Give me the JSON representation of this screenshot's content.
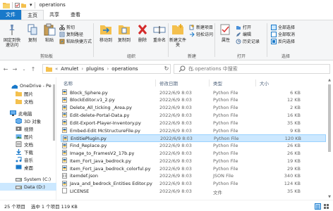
{
  "window": {
    "title": "operations"
  },
  "tabs": [
    {
      "label": "文件",
      "kind": "file"
    },
    {
      "label": "主页",
      "kind": "active"
    },
    {
      "label": "共享",
      "kind": "normal"
    },
    {
      "label": "查看",
      "kind": "normal"
    }
  ],
  "ribbon": {
    "clipboard": {
      "group_label": "剪贴板",
      "pin_label": "固定到快速访问",
      "copy_label": "复制",
      "paste_label": "粘贴",
      "cut_label": "剪切",
      "copy_path_label": "复制路径",
      "paste_shortcut_label": "粘贴快捷方式"
    },
    "organize": {
      "group_label": "组织",
      "move_to_label": "移动到",
      "copy_to_label": "复制到",
      "delete_label": "删除",
      "rename_label": "重命名"
    },
    "new": {
      "group_label": "新建",
      "new_folder_label": "新建文件夹",
      "new_item_label": "新建项目",
      "easy_access_label": "轻松访问"
    },
    "open": {
      "group_label": "打开",
      "properties_label": "属性",
      "open_label": "打开",
      "edit_label": "编辑",
      "history_label": "历史记录"
    },
    "select": {
      "group_label": "选择",
      "select_all_label": "全部选择",
      "select_none_label": "全部取消",
      "invert_label": "反向选择"
    }
  },
  "address": {
    "sep_root": "«",
    "crumbs": [
      "Amulet",
      "plugins",
      "operations"
    ],
    "sep": "›",
    "refresh_icon": "refresh-icon"
  },
  "search": {
    "placeholder": "在 operations 中搜索"
  },
  "sidebar": {
    "items": [
      {
        "label": "OneDrive - Pe",
        "icon": "cloud-icon",
        "selected": false
      },
      {
        "label": "图片",
        "icon": "folder-icon",
        "selected": false
      },
      {
        "label": "文档",
        "icon": "folder-icon",
        "selected": false
      },
      {
        "label": "此电脑",
        "icon": "computer-icon",
        "selected": false
      },
      {
        "label": "3D 对象",
        "icon": "3d-objects-icon",
        "selected": false
      },
      {
        "label": "视频",
        "icon": "video-icon",
        "selected": false
      },
      {
        "label": "图片",
        "icon": "pictures-icon",
        "selected": false
      },
      {
        "label": "文档",
        "icon": "documents-icon",
        "selected": false
      },
      {
        "label": "下载",
        "icon": "download-icon",
        "selected": false
      },
      {
        "label": "音乐",
        "icon": "music-icon",
        "selected": false
      },
      {
        "label": "桌面",
        "icon": "desktop-icon",
        "selected": false
      },
      {
        "label": "System (C:)",
        "icon": "drive-icon",
        "selected": false
      },
      {
        "label": "Data (D:)",
        "icon": "drive-icon",
        "selected": true
      }
    ]
  },
  "columns": {
    "name": "名称",
    "date": "修改日期",
    "type": "类型",
    "size": "大小"
  },
  "files": [
    {
      "name": "Block_Sphere.py",
      "date": "2022/6/9 8:03",
      "type": "Python File",
      "size": "6 KB",
      "icon": "python-file-icon",
      "selected": false
    },
    {
      "name": "BlockEditor.v1_2.py",
      "date": "2022/6/9 8:03",
      "type": "Python File",
      "size": "12 KB",
      "icon": "python-file-icon",
      "selected": false
    },
    {
      "name": "Delete_All_ticking _Area.py",
      "date": "2022/6/9 8:03",
      "type": "Python File",
      "size": "2 KB",
      "icon": "python-file-icon",
      "selected": false
    },
    {
      "name": "Edit-delete-Portal-Data.py",
      "date": "2022/6/9 8:03",
      "type": "Python File",
      "size": "16 KB",
      "icon": "python-file-icon",
      "selected": false
    },
    {
      "name": "Edit-Export-Player-Inventory.py",
      "date": "2022/6/9 8:03",
      "type": "Python File",
      "size": "35 KB",
      "icon": "python-file-icon",
      "selected": false
    },
    {
      "name": "Embed-Edit McStructureFile.py",
      "date": "2022/6/9 8:03",
      "type": "Python File",
      "size": "9 KB",
      "icon": "python-file-icon",
      "selected": false
    },
    {
      "name": "EntitiePlugin.py",
      "date": "2022/6/9 8:03",
      "type": "Python File",
      "size": "120 KB",
      "icon": "python-file-icon",
      "selected": true
    },
    {
      "name": "Find_Replace.py",
      "date": "2022/6/9 8:03",
      "type": "Python File",
      "size": "26 KB",
      "icon": "python-file-icon",
      "selected": false
    },
    {
      "name": "Image_to_FramesV2_17b.py",
      "date": "2022/6/9 8:03",
      "type": "Python File",
      "size": "26 KB",
      "icon": "python-file-icon",
      "selected": false
    },
    {
      "name": "Item_Fort_java_bedrock.py",
      "date": "2022/6/9 8:03",
      "type": "Python File",
      "size": "19 KB",
      "icon": "python-file-icon",
      "selected": false
    },
    {
      "name": "Item_Fort_java_bedrock_colorful.py",
      "date": "2022/6/9 8:03",
      "type": "Python File",
      "size": "29 KB",
      "icon": "python-file-icon",
      "selected": false
    },
    {
      "name": "itemdef.json",
      "date": "2022/6/9 8:03",
      "type": "JSON File",
      "size": "340 KB",
      "icon": "json-file-icon",
      "selected": false
    },
    {
      "name": "Java_and_bedrock_Entities Editor.py",
      "date": "2022/6/9 8:03",
      "type": "Python File",
      "size": "124 KB",
      "icon": "python-file-icon",
      "selected": false
    },
    {
      "name": "LICENSE",
      "date": "2022/6/9 8:03",
      "type": "文件",
      "size": "35 KB",
      "icon": "blank-file-icon",
      "selected": false
    }
  ],
  "status": {
    "count": "25 个项目",
    "selected": "选中 1 个项目  119 KB"
  },
  "colors": {
    "accent": "#1979ca",
    "selection": "#cce8ff",
    "selection_border": "#99d1ff",
    "folder": "#f4c04e",
    "python": "#3572a5"
  }
}
